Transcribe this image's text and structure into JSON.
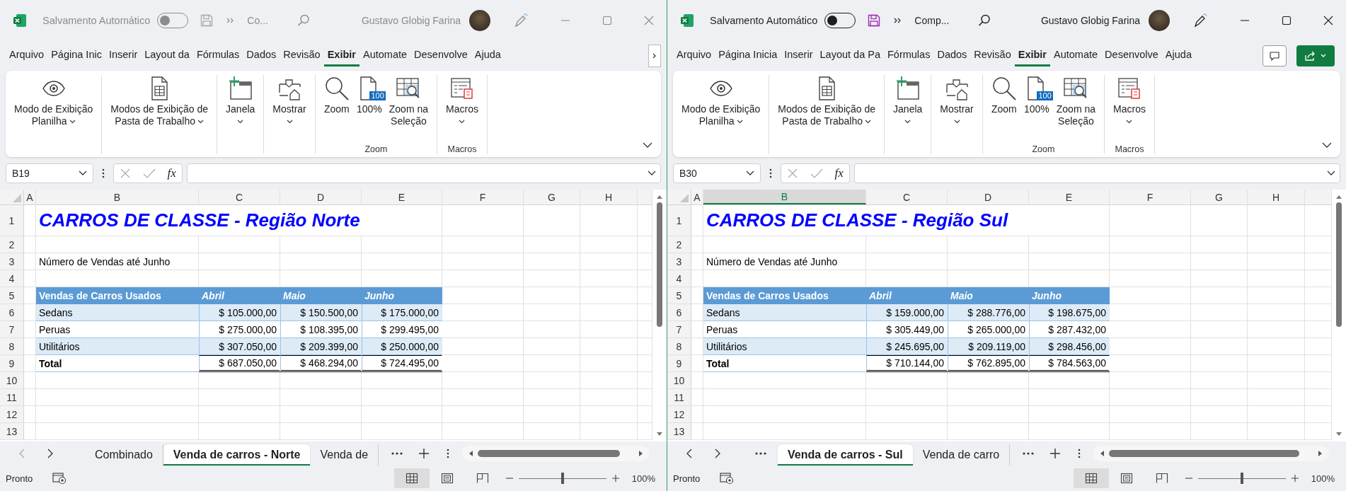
{
  "windows": [
    {
      "active": false,
      "title_bar": {
        "autosave_label": "Salvamento Automático",
        "autosave_on": false,
        "document": "Co...",
        "user": "Gustavo Globig Farina"
      },
      "ribbon_tabs": [
        {
          "label": "Arquivo",
          "selected": false
        },
        {
          "label": "Página Inic",
          "selected": false
        },
        {
          "label": "Inserir",
          "selected": false
        },
        {
          "label": "Layout da",
          "selected": false
        },
        {
          "label": "Fórmulas",
          "selected": false
        },
        {
          "label": "Dados",
          "selected": false
        },
        {
          "label": "Revisão",
          "selected": false
        },
        {
          "label": "Exibir",
          "selected": true
        },
        {
          "label": "Automate",
          "selected": false
        },
        {
          "label": "Desenvolve",
          "selected": false
        },
        {
          "label": "Ajuda",
          "selected": false
        }
      ],
      "ribbon_overflow": true,
      "share_buttons": false,
      "ribbon_groups": [
        {
          "buttons": [
            {
              "kind": "eye",
              "lines": [
                "Modo de Exibição",
                "Planilha"
              ],
              "dropdown": true
            }
          ]
        },
        {
          "buttons": [
            {
              "kind": "page",
              "lines": [
                "Modos de Exibição de",
                "Pasta de Trabalho"
              ],
              "dropdown": true
            }
          ]
        },
        {
          "buttons": [
            {
              "kind": "window",
              "lines": [
                "Janela"
              ],
              "dropdown": true
            }
          ]
        },
        {
          "buttons": [
            {
              "kind": "show",
              "lines": [
                "Mostrar"
              ],
              "dropdown": true
            }
          ]
        },
        {
          "label": "Zoom",
          "buttons": [
            {
              "kind": "zoom",
              "lines": [
                "Zoom"
              ],
              "dropdown": false
            },
            {
              "kind": "hundred",
              "badge": "100",
              "lines": [
                "100%"
              ],
              "dropdown": false
            },
            {
              "kind": "selection",
              "lines": [
                "Zoom na",
                "Seleção"
              ],
              "dropdown": false
            }
          ]
        },
        {
          "label": "Macros",
          "buttons": [
            {
              "kind": "macros",
              "lines": [
                "Macros"
              ],
              "dropdown": true
            }
          ]
        }
      ],
      "name_box": "B19",
      "formula_label": "fx",
      "columns": [
        {
          "label": "A",
          "selected": false
        },
        {
          "label": "B",
          "selected": false
        },
        {
          "label": "C",
          "selected": false
        },
        {
          "label": "D",
          "selected": false
        },
        {
          "label": "E",
          "selected": false
        },
        {
          "label": "F",
          "selected": false
        },
        {
          "label": "G",
          "selected": false
        },
        {
          "label": "H",
          "selected": false
        }
      ],
      "rows": [
        "1",
        "2",
        "3",
        "4",
        "5",
        "6",
        "7",
        "8",
        "9",
        "10",
        "11",
        "12",
        "13"
      ],
      "sheet": {
        "title": "CARROS DE CLASSE - Região Norte",
        "subtitle": "Número de Vendas até Junho",
        "table": {
          "headers": [
            "Vendas de Carros Usados",
            "Abril",
            "Maio",
            "Junho"
          ],
          "rows": [
            {
              "label": "Sedans",
              "values": [
                "$ 105.000,00",
                "$ 150.500,00",
                "$ 175.000,00"
              ]
            },
            {
              "label": "Peruas",
              "values": [
                "$ 275.000,00",
                "$ 108.395,00",
                "$ 299.495,00"
              ]
            },
            {
              "label": "Utilitários",
              "values": [
                "$ 307.050,00",
                "$ 209.399,00",
                "$ 250.000,00"
              ]
            }
          ],
          "total": {
            "label": "Total",
            "values": [
              "$ 687.050,00",
              "$ 468.294,00",
              "$ 724.495,00"
            ]
          }
        }
      },
      "sheet_nav": {
        "prev_disabled": true,
        "leading_more": false
      },
      "sheet_tabs": [
        {
          "label": "Combinado",
          "selected": false
        },
        {
          "label": "Venda de carros - Norte",
          "selected": true
        },
        {
          "label": "Venda de",
          "selected": false
        }
      ],
      "status": {
        "text": "Pronto",
        "views": [
          {
            "kind": "normal",
            "selected": true
          },
          {
            "kind": "layout",
            "selected": false
          },
          {
            "kind": "breaks",
            "selected": false
          }
        ],
        "zoom": {
          "level": 0.5
        },
        "zoom_text": "100%"
      }
    },
    {
      "active": true,
      "title_bar": {
        "autosave_label": "Salvamento Automático",
        "autosave_on": false,
        "document": "Comp...",
        "user": "Gustavo Globig Farina"
      },
      "ribbon_tabs": [
        {
          "label": "Arquivo",
          "selected": false
        },
        {
          "label": "Página Inicia",
          "selected": false
        },
        {
          "label": "Inserir",
          "selected": false
        },
        {
          "label": "Layout da Pa",
          "selected": false
        },
        {
          "label": "Fórmulas",
          "selected": false
        },
        {
          "label": "Dados",
          "selected": false
        },
        {
          "label": "Revisão",
          "selected": false
        },
        {
          "label": "Exibir",
          "selected": true
        },
        {
          "label": "Automate",
          "selected": false
        },
        {
          "label": "Desenvolve",
          "selected": false
        },
        {
          "label": "Ajuda",
          "selected": false
        }
      ],
      "ribbon_overflow": false,
      "share_buttons": true,
      "ribbon_groups": [
        {
          "buttons": [
            {
              "kind": "eye",
              "lines": [
                "Modo de Exibição",
                "Planilha"
              ],
              "dropdown": true
            }
          ]
        },
        {
          "buttons": [
            {
              "kind": "page",
              "lines": [
                "Modos de Exibição de",
                "Pasta de Trabalho"
              ],
              "dropdown": true
            }
          ]
        },
        {
          "buttons": [
            {
              "kind": "window",
              "lines": [
                "Janela"
              ],
              "dropdown": true
            }
          ]
        },
        {
          "buttons": [
            {
              "kind": "show",
              "lines": [
                "Mostrar"
              ],
              "dropdown": true
            }
          ]
        },
        {
          "label": "Zoom",
          "buttons": [
            {
              "kind": "zoom",
              "lines": [
                "Zoom"
              ],
              "dropdown": false
            },
            {
              "kind": "hundred",
              "badge": "100",
              "lines": [
                "100%"
              ],
              "dropdown": false
            },
            {
              "kind": "selection",
              "lines": [
                "Zoom na",
                "Seleção"
              ],
              "dropdown": false
            }
          ]
        },
        {
          "label": "Macros",
          "buttons": [
            {
              "kind": "macros",
              "lines": [
                "Macros"
              ],
              "dropdown": true
            }
          ]
        }
      ],
      "name_box": "B30",
      "formula_label": "fx",
      "columns": [
        {
          "label": "A",
          "selected": false
        },
        {
          "label": "B",
          "selected": true
        },
        {
          "label": "C",
          "selected": false
        },
        {
          "label": "D",
          "selected": false
        },
        {
          "label": "E",
          "selected": false
        },
        {
          "label": "F",
          "selected": false
        },
        {
          "label": "G",
          "selected": false
        },
        {
          "label": "H",
          "selected": false
        }
      ],
      "rows": [
        "1",
        "2",
        "3",
        "4",
        "5",
        "6",
        "7",
        "8",
        "9",
        "10",
        "11",
        "12",
        "13"
      ],
      "sheet": {
        "title": "CARROS DE CLASSE - Região Sul",
        "subtitle": "Número de Vendas até Junho",
        "table": {
          "headers": [
            "Vendas de Carros Usados",
            "Abril",
            "Maio",
            "Junho"
          ],
          "rows": [
            {
              "label": "Sedans",
              "values": [
                "$ 159.000,00",
                "$ 288.776,00",
                "$ 198.675,00"
              ]
            },
            {
              "label": "Peruas",
              "values": [
                "$ 305.449,00",
                "$ 265.000,00",
                "$ 287.432,00"
              ]
            },
            {
              "label": "Utilitários",
              "values": [
                "$ 245.695,00",
                "$ 209.119,00",
                "$ 298.456,00"
              ]
            }
          ],
          "total": {
            "label": "Total",
            "values": [
              "$ 710.144,00",
              "$ 762.895,00",
              "$ 784.563,00"
            ]
          }
        }
      },
      "sheet_nav": {
        "prev_disabled": false,
        "leading_more": true
      },
      "sheet_tabs": [
        {
          "label": "Venda de carros - Sul",
          "selected": true
        },
        {
          "label": "Venda de carro",
          "selected": false
        }
      ],
      "status": {
        "text": "Pronto",
        "views": [
          {
            "kind": "normal",
            "selected": true
          },
          {
            "kind": "layout",
            "selected": false
          },
          {
            "kind": "breaks",
            "selected": false
          }
        ],
        "zoom": {
          "level": 0.5
        },
        "zoom_text": "100%"
      }
    }
  ]
}
